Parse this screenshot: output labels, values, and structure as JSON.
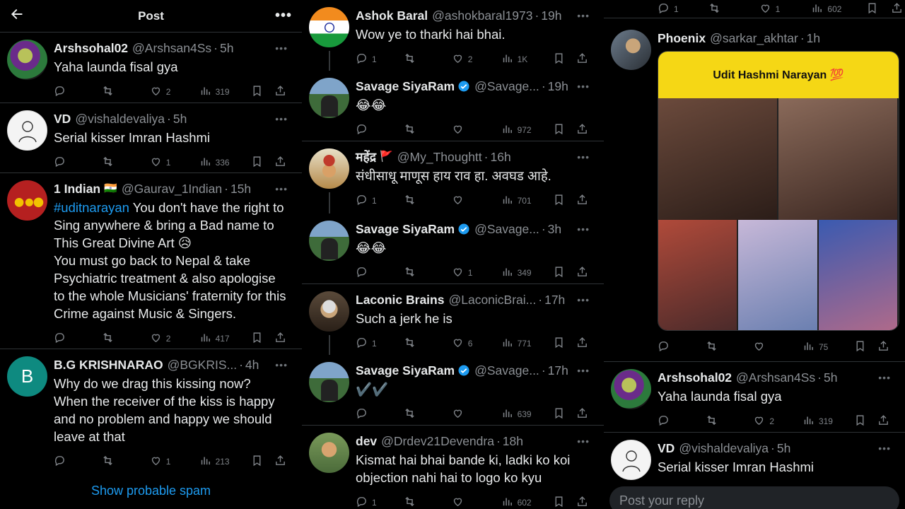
{
  "header": {
    "title": "Post"
  },
  "panel1": {
    "tweets": [
      {
        "name": "Arshsohal02",
        "handle": "@Arshsan4Ss",
        "time": "5h",
        "text": "Yaha launda fisal gya",
        "replies": "",
        "retweets": "",
        "likes": "2",
        "views": "319"
      },
      {
        "name": "VD",
        "handle": "@vishaldevaliya",
        "time": "5h",
        "text": "Serial kisser Imran Hashmi",
        "replies": "",
        "retweets": "",
        "likes": "1",
        "views": "336"
      },
      {
        "name": "1 Indian",
        "flag": "🇮🇳",
        "handle": "@Gaurav_1Indian",
        "time": "15h",
        "hashtag": "#uditnarayan",
        "text": " You don't have the right to Sing anywhere & bring a Bad name to This Great Divine Art 😥\nYou must go back to Nepal & take Psychiatric treatment & also apologise to the whole Musicians' fraternity for this Crime against Music & Singers.",
        "replies": "",
        "retweets": "",
        "likes": "2",
        "views": "417"
      },
      {
        "name": "B.G KRISHNARAO",
        "handle": "@BGKRIS...",
        "time": "4h",
        "avatar_letter": "B",
        "text": "Why do we drag this kissing now? When the receiver of the kiss is happy and no problem and happy we should leave at that",
        "replies": "",
        "retweets": "",
        "likes": "1",
        "views": "213"
      }
    ],
    "spam_link": "Show probable spam"
  },
  "panel2": {
    "tweets": [
      {
        "name": "Ashok Baral",
        "handle": "@ashokbaral1973",
        "time": "19h",
        "text": "Wow ye to tharki hai bhai.",
        "replies": "1",
        "retweets": "",
        "likes": "2",
        "views": "1K"
      },
      {
        "name": "Savage SiyaRam",
        "verified": true,
        "handle": "@Savage...",
        "time": "19h",
        "text": "😂😂",
        "replies": "",
        "retweets": "",
        "likes": "",
        "views": "972"
      },
      {
        "name": "महेंद्र",
        "flag": "🚩",
        "handle": "@My_Thoughtt",
        "time": "16h",
        "text": "संधीसाधू माणूस हाय राव हा. अवघड आहे.",
        "replies": "1",
        "retweets": "",
        "likes": "",
        "views": "701"
      },
      {
        "name": "Savage SiyaRam",
        "verified": true,
        "handle": "@Savage...",
        "time": "3h",
        "text": "😂😂",
        "replies": "",
        "retweets": "",
        "likes": "1",
        "views": "349"
      },
      {
        "name": "Laconic Brains",
        "handle": "@LaconicBrai...",
        "time": "17h",
        "text": "Such a jerk he is",
        "replies": "1",
        "retweets": "",
        "likes": "6",
        "views": "771"
      },
      {
        "name": "Savage SiyaRam",
        "verified": true,
        "handle": "@Savage...",
        "time": "17h",
        "text": "✔️✔️",
        "replies": "",
        "retweets": "",
        "likes": "",
        "views": "639"
      },
      {
        "name": "dev",
        "handle": "@Drdev21Devendra",
        "time": "18h",
        "text": "Kismat hai bhai bande ki, ladki ko koi objection nahi hai to logo ko kyu",
        "replies": "1",
        "retweets": "",
        "likes": "",
        "views": "602"
      }
    ]
  },
  "panel3": {
    "top_actions": {
      "replies": "1",
      "retweets": "",
      "likes": "1",
      "views": "602"
    },
    "tweets": [
      {
        "name": "Phoenix",
        "handle": "@sarkar_akhtar",
        "time": "1h",
        "media_title": "Udit Hashmi Narayan 💯",
        "replies": "",
        "retweets": "",
        "likes": "",
        "views": "75"
      },
      {
        "name": "Arshsohal02",
        "handle": "@Arshsan4Ss",
        "time": "5h",
        "text": "Yaha launda fisal gya",
        "replies": "",
        "retweets": "",
        "likes": "2",
        "views": "319"
      },
      {
        "name": "VD",
        "handle": "@vishaldevaliya",
        "time": "5h",
        "text": "Serial kisser Imran Hashmi"
      }
    ],
    "reply_placeholder": "Post your reply"
  },
  "colors": {
    "background": "#000000",
    "accent": "#1d9bf0",
    "muted": "#8b8f94",
    "divider": "#2f3336"
  },
  "icons": [
    "back-arrow-icon",
    "more-icon",
    "reply-icon",
    "retweet-icon",
    "like-icon",
    "views-icon",
    "bookmark-icon",
    "share-icon",
    "verified-icon"
  ]
}
